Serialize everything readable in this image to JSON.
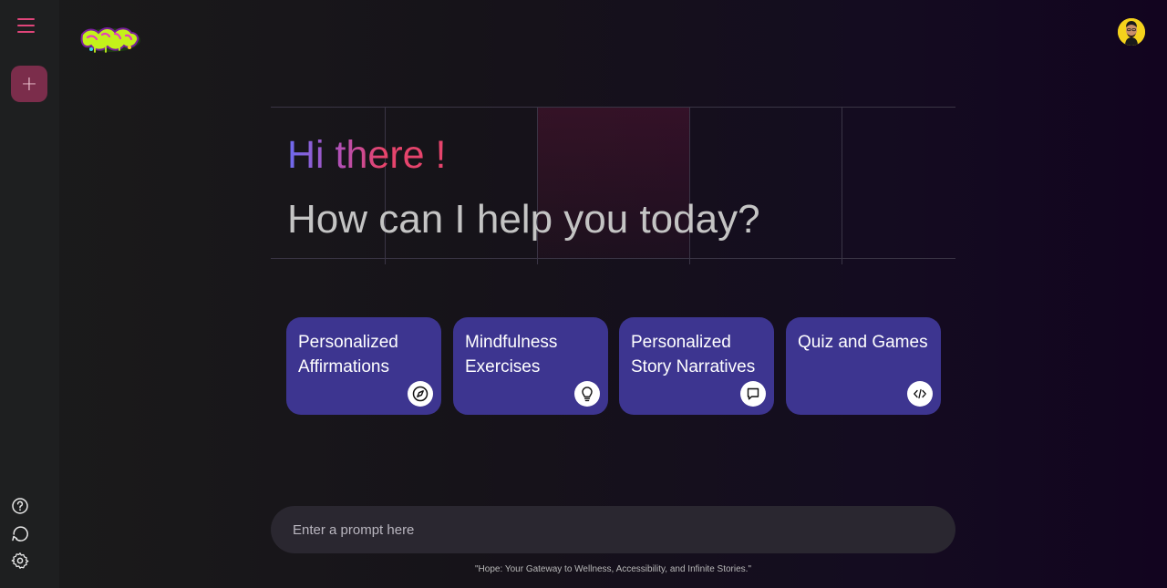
{
  "sidebar": {
    "menu_icon": "hamburger-menu-icon",
    "new_chat_symbol": "+",
    "bottom_icons": [
      "help-icon",
      "history-icon",
      "settings-icon"
    ]
  },
  "header": {
    "logo_icon": "hope-graffiti-logo",
    "avatar_icon": "user-avatar"
  },
  "hero": {
    "greeting": "Hi there !",
    "subtitle": "How can I help you today?"
  },
  "cards": [
    {
      "label": "Personalized Affirmations",
      "icon": "compass-icon"
    },
    {
      "label": "Mindfulness Exercises",
      "icon": "lightbulb-icon"
    },
    {
      "label": "Personalized Story Narratives",
      "icon": "chat-bubble-icon"
    },
    {
      "label": "Quiz and Games",
      "icon": "code-icon"
    }
  ],
  "prompt": {
    "placeholder": "Enter a prompt here"
  },
  "footer": {
    "tagline": "\"Hope: Your Gateway to Wellness, Accessibility, and Infinite Stories.\""
  },
  "colors": {
    "accent": "#e0457a",
    "new_button": "#7b2d4b",
    "card": "#3d3590",
    "greeting_gradient": [
      "#6c6bf0",
      "#b64fb2",
      "#e6446c"
    ],
    "subtitle": "#c4c4c4"
  }
}
